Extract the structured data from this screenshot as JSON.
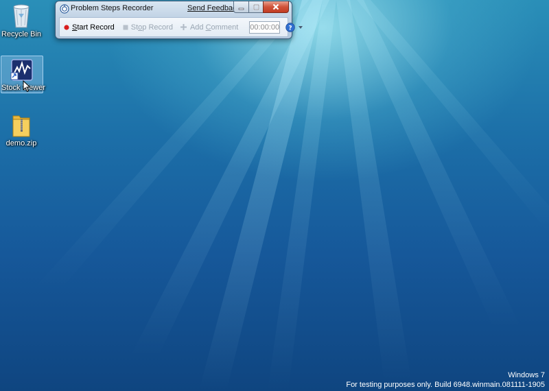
{
  "desktop": {
    "icons": [
      {
        "label": "Recycle Bin"
      },
      {
        "label": "Stock Viewer"
      },
      {
        "label": "demo.zip"
      }
    ]
  },
  "psr_window": {
    "title": "Problem Steps Recorder",
    "send_feedback": "Send Feedback",
    "toolbar": {
      "start_record_accel": "S",
      "start_record_rest": "tart Record",
      "stop_record_pre": "St",
      "stop_record_accel": "o",
      "stop_record_rest": "p Record",
      "add_comment_pre": "Add ",
      "add_comment_accel": "C",
      "add_comment_rest": "omment",
      "timer": "00:00:00"
    }
  },
  "watermark": {
    "line1": "Windows 7",
    "line2": "For testing purposes only. Build 6948.winmain.081111-1905"
  },
  "colors": {
    "record_red": "#d81e1e",
    "help_blue": "#2f6fd0",
    "close_red": "#c23b22"
  }
}
